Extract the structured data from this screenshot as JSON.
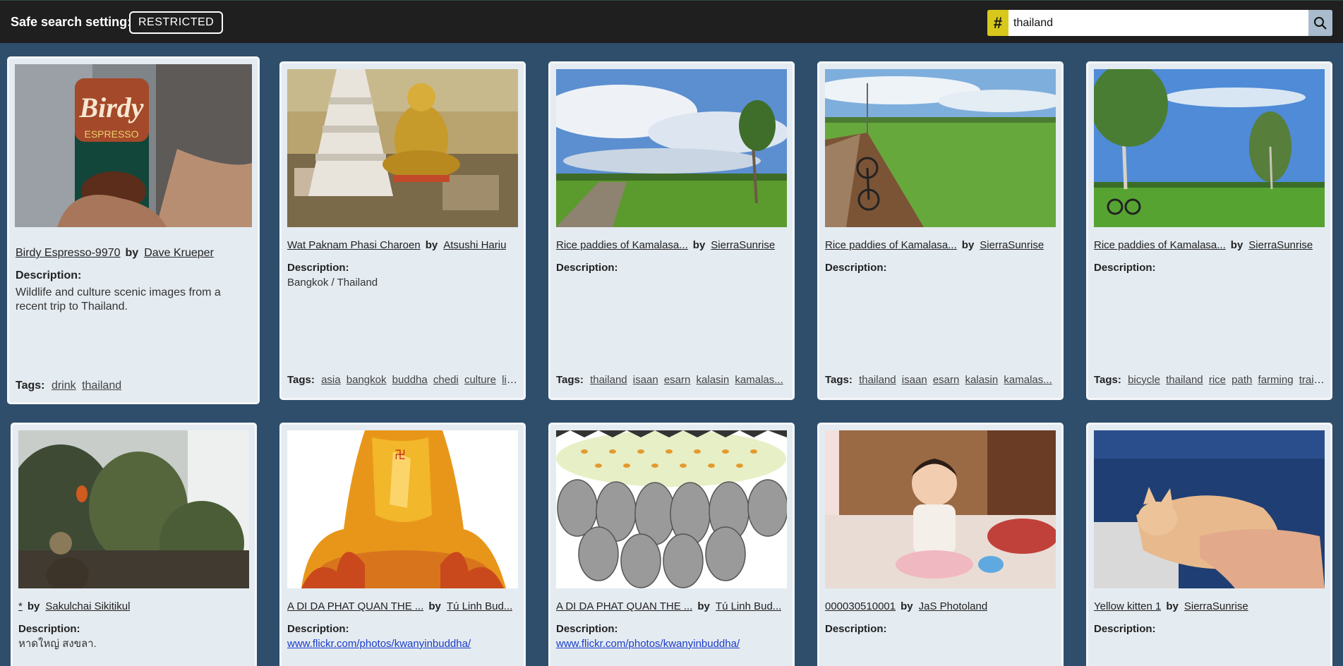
{
  "header": {
    "safe_search_label": "Safe search setting:",
    "safe_search_value": "RESTRICTED",
    "search_value": "thailand",
    "hash_symbol": "#"
  },
  "labels": {
    "by": "by",
    "description": "Description:",
    "tags": "Tags:"
  },
  "cards": [
    {
      "title": "Birdy Espresso-9970",
      "author": "Dave Krueper",
      "description": "Wildlife and culture scenic images from a recent trip to Thailand.",
      "tags": [
        "drink",
        "thailand"
      ]
    },
    {
      "title": "Wat Paknam Phasi Charoen",
      "author": "Atsushi Hariu",
      "description": "Bangkok / Thailand",
      "tags": [
        "asia",
        "bangkok",
        "buddha",
        "chedi",
        "culture",
        "li..."
      ]
    },
    {
      "title": "Rice paddies of Kamalasa...",
      "author": "SierraSunrise",
      "description": "",
      "tags": [
        "thailand",
        "isaan",
        "esarn",
        "kalasin",
        "kamalas..."
      ]
    },
    {
      "title": "Rice paddies of Kamalasa...",
      "author": "SierraSunrise",
      "description": "",
      "tags": [
        "thailand",
        "isaan",
        "esarn",
        "kalasin",
        "kamalas..."
      ]
    },
    {
      "title": "Rice paddies of Kamalasa...",
      "author": "SierraSunrise",
      "description": "",
      "tags": [
        "bicycle",
        "thailand",
        "rice",
        "path",
        "farming",
        "trail..."
      ]
    },
    {
      "title": "*",
      "author": "Sakulchai Sikitikul",
      "description": "หาดใหญ่ สงขลา.",
      "tags": []
    },
    {
      "title": "A DI DA PHAT QUAN THE ...",
      "author": "Tú Linh Bud...",
      "description_link": "www.flickr.com/photos/kwanyinbuddha/",
      "tags": []
    },
    {
      "title": "A DI DA PHAT QUAN THE ...",
      "author": "Tú Linh Bud...",
      "description_link": "www.flickr.com/photos/kwanyinbuddha/",
      "tags": []
    },
    {
      "title": "000030510001",
      "author": "JaS Photoland",
      "description": "",
      "tags": []
    },
    {
      "title": "Yellow kitten 1",
      "author": "SierraSunrise",
      "description": "",
      "tags": []
    }
  ]
}
